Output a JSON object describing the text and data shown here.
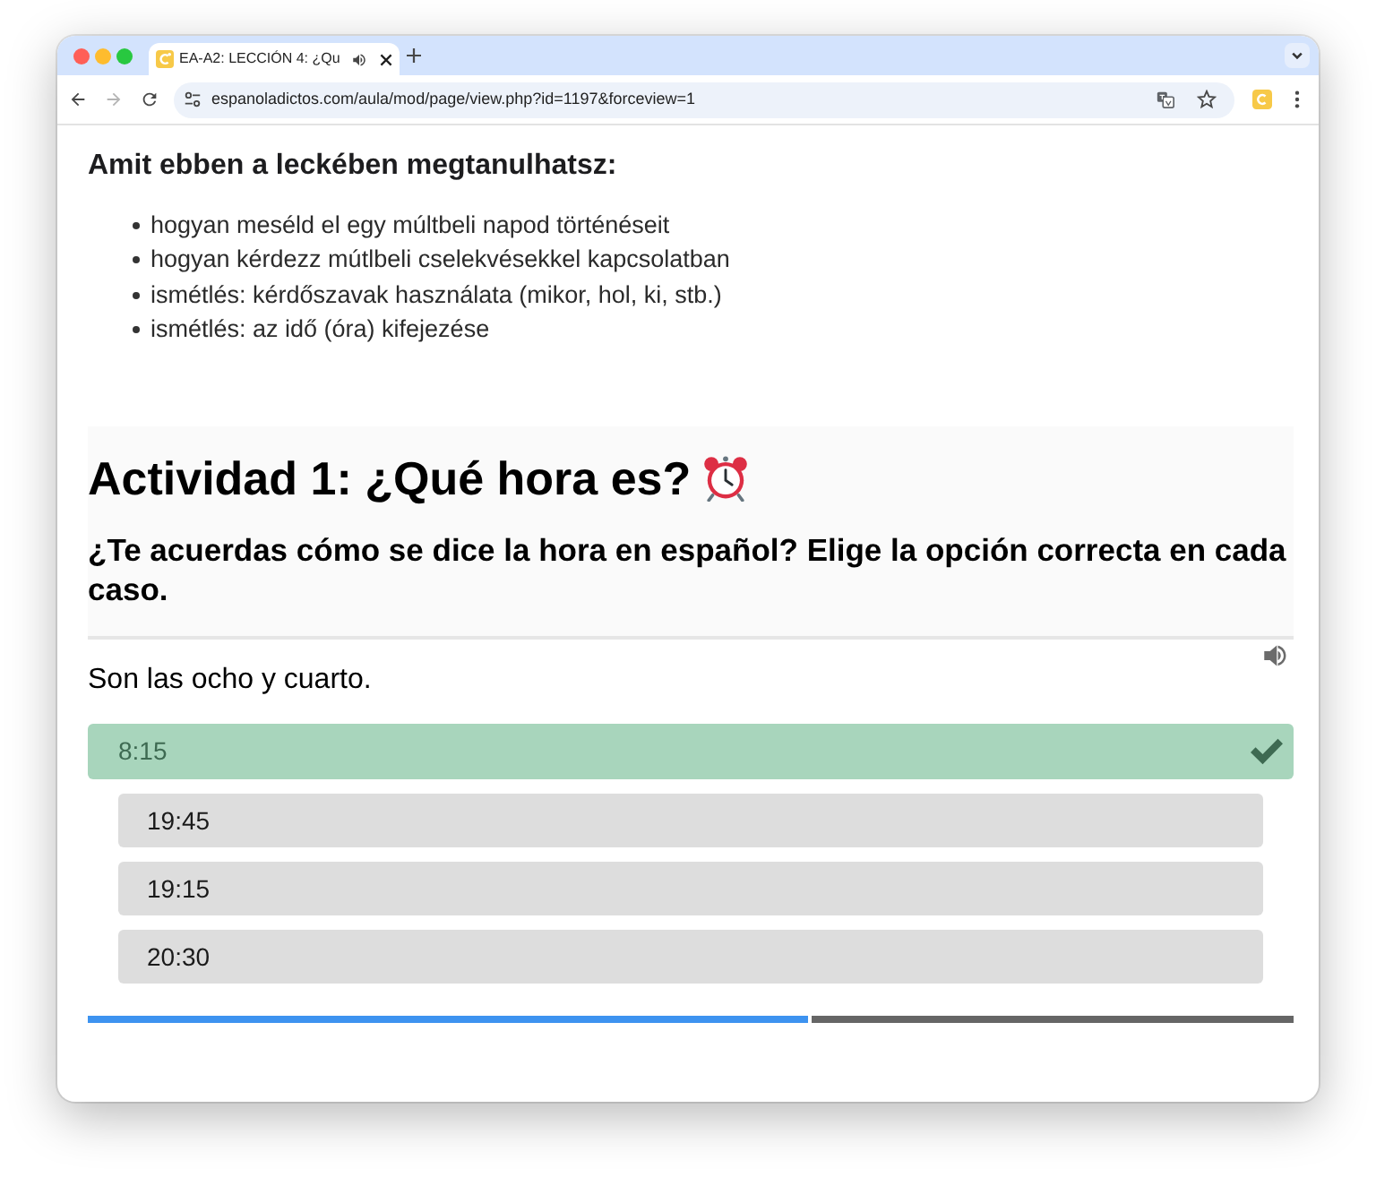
{
  "tabs": [
    {
      "title": "EA-A2: LECCIÓN 4: ¿Qu",
      "selected": true,
      "audio": true
    }
  ],
  "address_bar": {
    "url": "espanoladictos.com/aula/mod/page/view.php?id=1197&forceview=1"
  },
  "lesson": {
    "heading": "Amit ebben a leckében megtanulhatsz:",
    "goals": [
      "hogyan meséld el egy múltbeli napod történéseit",
      "hogyan kérdezz mútlbeli cselekvésekkel kapcsolatban",
      "ismétlés: kérdőszavak használata (mikor, hol, ki, stb.)",
      "ismétlés: az idő (óra) kifejezése"
    ]
  },
  "activity": {
    "title": "Actividad 1: ¿Qué hora es?",
    "instruction": "¿Te acuerdas cómo se dice la hora en español? Elige la opción correcta en cada caso.",
    "prompt": "Son las ocho y cuarto.",
    "options": [
      {
        "label": "8:15",
        "selected": true
      },
      {
        "label": "19:45",
        "selected": false
      },
      {
        "label": "19:15",
        "selected": false
      },
      {
        "label": "20:30",
        "selected": false
      }
    ],
    "progress": {
      "level": 0.6
    }
  }
}
